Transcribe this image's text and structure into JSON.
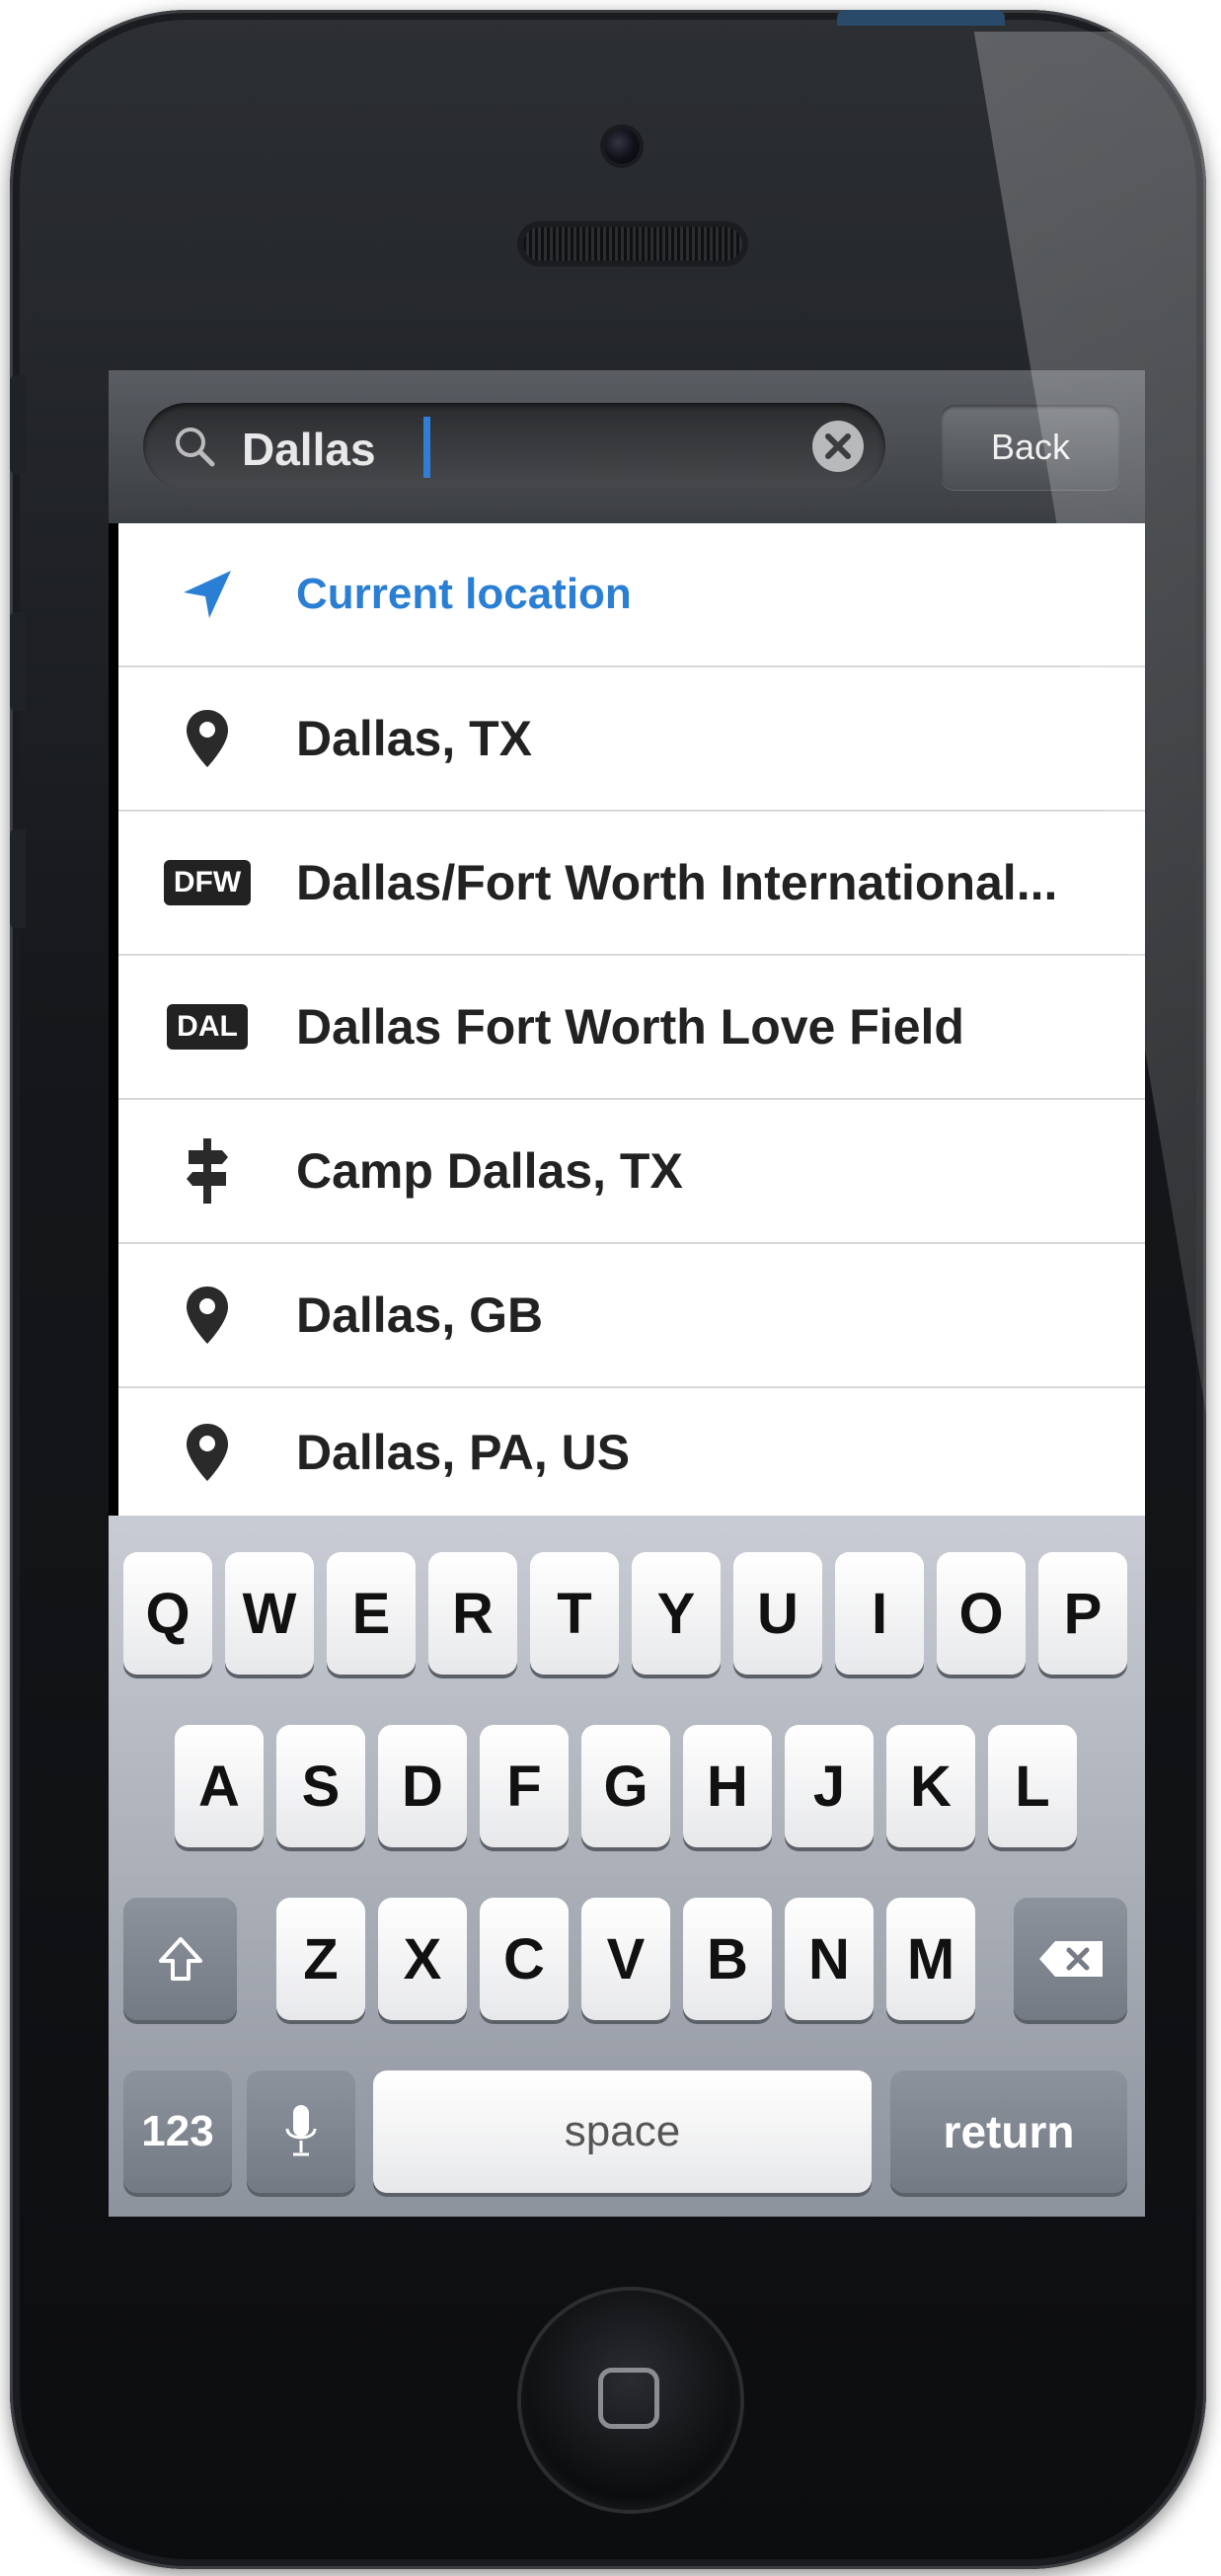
{
  "search": {
    "value": "Dallas",
    "back_label": "Back"
  },
  "results": [
    {
      "icon": "location-arrow-icon",
      "label": "Current location"
    },
    {
      "icon": "map-pin-icon",
      "label": "Dallas, TX"
    },
    {
      "icon": "airport-badge",
      "badge": "DFW",
      "label": "Dallas/Fort Worth International..."
    },
    {
      "icon": "airport-badge",
      "badge": "DAL",
      "label": "Dallas Fort Worth Love Field"
    },
    {
      "icon": "signpost-icon",
      "label": "Camp Dallas, TX"
    },
    {
      "icon": "map-pin-icon",
      "label": "Dallas, GB"
    },
    {
      "icon": "map-pin-icon",
      "label": "Dallas, PA, US"
    }
  ],
  "keyboard": {
    "row1": [
      "Q",
      "W",
      "E",
      "R",
      "T",
      "Y",
      "U",
      "I",
      "O",
      "P"
    ],
    "row2": [
      "A",
      "S",
      "D",
      "F",
      "G",
      "H",
      "J",
      "K",
      "L"
    ],
    "row3": [
      "Z",
      "X",
      "C",
      "V",
      "B",
      "N",
      "M"
    ],
    "numbers_label": "123",
    "space_label": "space",
    "return_label": "return"
  },
  "colors": {
    "accent": "#2a7fd4",
    "text": "#222222"
  }
}
